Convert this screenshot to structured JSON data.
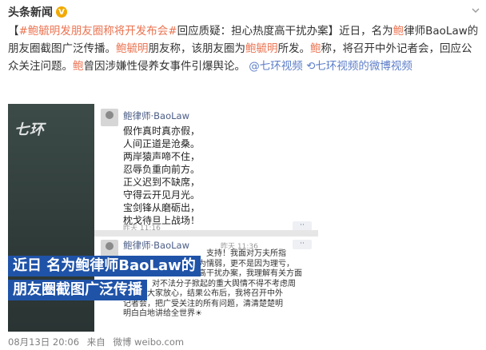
{
  "header": {
    "author": "头条新闻",
    "badge": "V"
  },
  "post": {
    "seg_bracket_open": "【",
    "hashtag": "#鲍毓明发朋友圈称将开发布会#",
    "seg1": "回应质疑：担心热度高干扰办案】近日，名为",
    "name_a": "鲍",
    "seg2": "律师BaoLaw的朋友圈截图广泛传播。",
    "name_b": "鲍毓明",
    "seg3": "朋友称，该朋友圈为",
    "name_c": "鲍毓明",
    "seg4": "所发。",
    "name_d": "鲍",
    "seg5": "称，将召开中外记者会，回应公众关注问题。",
    "name_e": "鲍",
    "seg6": "曾因涉嫌性侵养女事件引爆舆论。",
    "mention": "@七环视频",
    "link_icon": "⟲",
    "link_text": "七环视频的微博视频"
  },
  "video": {
    "watermark": "七环",
    "post1": {
      "name": "鲍律师·BaoLaw",
      "lines": [
        "假作真时真亦假，",
        "人间正道是沧桑。",
        "两岸猿声啼不住，",
        "忍辱负重向前方。",
        "正义迟到不缺席，",
        "守得云开见月光。",
        "宝剑锋从磨砺出，",
        "枕戈待旦上战场！"
      ],
      "time": "昨天 11:16"
    },
    "post2": {
      "name": "鲍律师·BaoLaw",
      "time": "昨天 11:36",
      "body_lines": [
        "支持！我面对万夫所指",
        "是因为懦弱，更不是因为理亏，",
        "心热度过高干扰办案，我理解有关方面",
        "对不法分子掀起的重大舆情不得不考虑周",
        "全。请大家放心，结果公布后，我将召开中外",
        "记者会，把广受关注的所有问题，清清楚楚明",
        "明白白地讲给全世界"
      ],
      "wave": "☀"
    },
    "caption_line1": "近日 名为鲍律师BaoLaw的",
    "caption_line2": "朋友圈截图广泛传播"
  },
  "footer": {
    "date": "08月13日 20:06",
    "from": "来自",
    "source": "微博 weibo.com"
  }
}
